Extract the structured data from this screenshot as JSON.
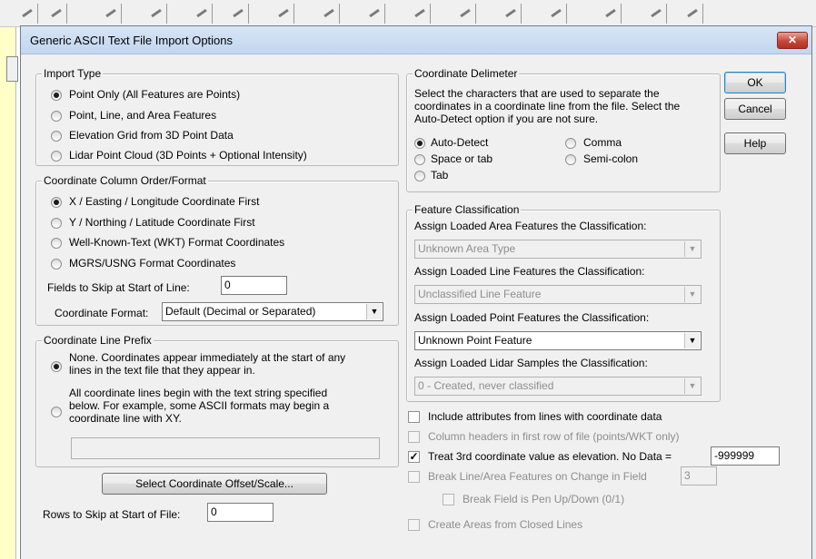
{
  "dialog": {
    "title": "Generic ASCII Text File Import Options",
    "close_label": "✕",
    "ok_label": "OK",
    "cancel_label": "Cancel",
    "help_label": "Help"
  },
  "import_type": {
    "legend": "Import Type",
    "options": [
      {
        "label": "Point Only (All Features are Points)",
        "selected": true
      },
      {
        "label": "Point, Line, and Area Features",
        "selected": false
      },
      {
        "label": "Elevation Grid from 3D Point Data",
        "selected": false
      },
      {
        "label": "Lidar Point Cloud (3D Points + Optional Intensity)",
        "selected": false
      }
    ]
  },
  "coord_order": {
    "legend": "Coordinate Column Order/Format",
    "options": [
      {
        "label": "X / Easting / Longitude Coordinate First",
        "selected": true
      },
      {
        "label": "Y / Northing / Latitude Coordinate First",
        "selected": false
      },
      {
        "label": "Well-Known-Text (WKT) Format Coordinates",
        "selected": false
      },
      {
        "label": "MGRS/USNG Format Coordinates",
        "selected": false
      }
    ],
    "fields_to_skip_label": "Fields to Skip at Start of Line:",
    "fields_to_skip_value": "0",
    "coord_format_label": "Coordinate Format:",
    "coord_format_value": "Default (Decimal or Separated)"
  },
  "line_prefix": {
    "legend": "Coordinate Line Prefix",
    "option_none_line1": "None. Coordinates appear immediately at the start of any",
    "option_none_line2": "lines in the text file that they appear in.",
    "option_prefix_line1": "All coordinate lines begin with the text string specified",
    "option_prefix_line2": "below. For example, some ASCII formats may begin a",
    "option_prefix_line3": "coordinate line with XY.",
    "prefix_value": ""
  },
  "offset_button_label": "Select Coordinate Offset/Scale...",
  "rows_to_skip_label": "Rows to Skip at Start of File:",
  "rows_to_skip_value": "0",
  "delimiter": {
    "legend": "Coordinate Delimeter",
    "desc_line1": "Select the characters that are used to separate the",
    "desc_line2": "coordinates in a coordinate line from the file. Select the",
    "desc_line3": "Auto-Detect option if you are not sure.",
    "options": [
      {
        "label": "Auto-Detect",
        "selected": true
      },
      {
        "label": "Comma",
        "selected": false
      },
      {
        "label": "Space or tab",
        "selected": false
      },
      {
        "label": "Semi-colon",
        "selected": false
      },
      {
        "label": "Tab",
        "selected": false
      }
    ]
  },
  "classification": {
    "legend": "Feature Classification",
    "area_label": "Assign Loaded Area Features the Classification:",
    "area_value": "Unknown Area Type",
    "line_label": "Assign Loaded Line Features the Classification:",
    "line_value": "Unclassified Line Feature",
    "point_label": "Assign Loaded Point Features the Classification:",
    "point_value": "Unknown Point Feature",
    "lidar_label": "Assign Loaded Lidar Samples the Classification:",
    "lidar_value": "0 - Created, never classified"
  },
  "checks": {
    "include_attrs": "Include attributes from lines with coordinate data",
    "column_headers": "Column headers in first row of file (points/WKT only)",
    "treat_3rd": "Treat 3rd coordinate value as elevation. No Data =",
    "nodata_value": "-999999",
    "break_line": "Break Line/Area Features on Change in Field",
    "break_field_value": "3",
    "pen_updown": "Break Field is Pen Up/Down (0/1)",
    "create_areas": "Create Areas from Closed Lines"
  },
  "colors": {
    "dialog_bg": "#f0f0f0",
    "title_bar": "#c9dbf1",
    "close_button": "#c4483a",
    "background_app_panel": "#ffffc8"
  }
}
